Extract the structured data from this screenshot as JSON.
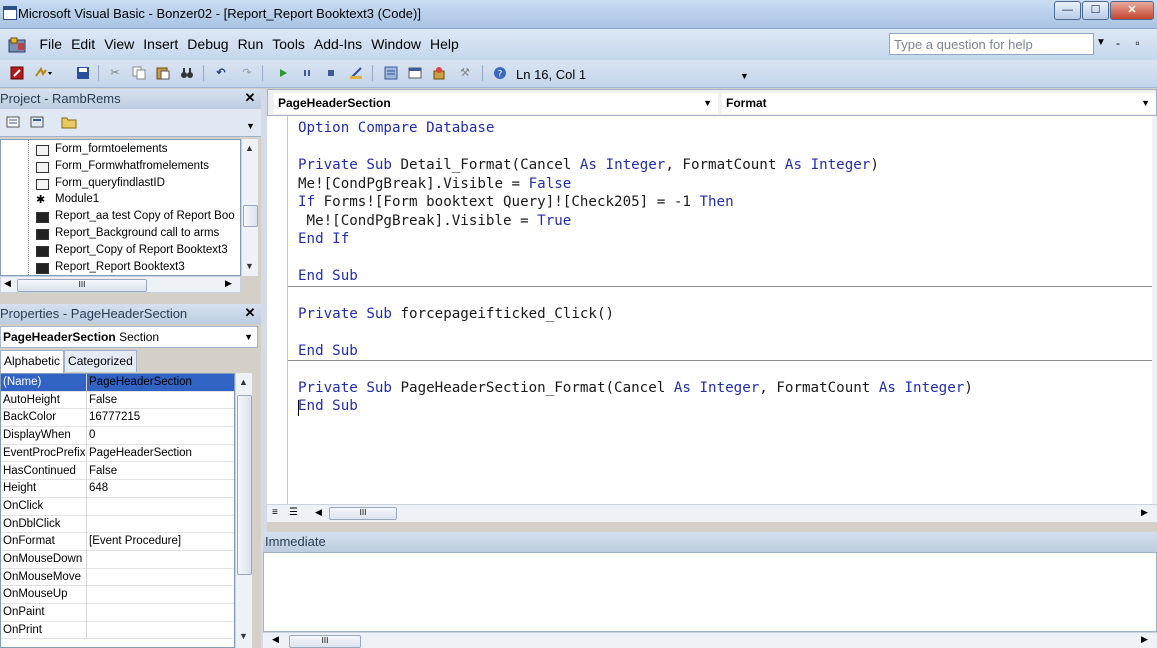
{
  "window": {
    "title": "Microsoft Visual Basic - Bonzer02 - [Report_Report Booktext3 (Code)]",
    "min_label": "—",
    "max_label": "☐",
    "close_label": "✕"
  },
  "menu": {
    "items": [
      "File",
      "Edit",
      "View",
      "Insert",
      "Debug",
      "Run",
      "Tools",
      "Add-Ins",
      "Window",
      "Help"
    ],
    "help_placeholder": "Type a question for help",
    "mdi_buttons": "- ▫"
  },
  "toolbar": {
    "position": "Ln 16, Col 1",
    "overflow": "▼"
  },
  "project": {
    "title": "Project - RambRems",
    "close": "✕",
    "tree": [
      {
        "label": "Form_formtoelements",
        "kind": "form"
      },
      {
        "label": "Form_Formwhatfromelements",
        "kind": "form"
      },
      {
        "label": "Form_queryfindlastID",
        "kind": "form"
      },
      {
        "label": "Module1",
        "kind": "module"
      },
      {
        "label": "Report_aa test Copy of Report Boo",
        "kind": "report"
      },
      {
        "label": "Report_Background call to arms",
        "kind": "report"
      },
      {
        "label": "Report_Copy of Report Booktext3",
        "kind": "report"
      },
      {
        "label": "Report_Report Booktext3",
        "kind": "report"
      }
    ],
    "hscroll_thumb": "III"
  },
  "properties": {
    "title": "Properties - PageHeaderSection",
    "close": "✕",
    "object_name": "PageHeaderSection",
    "object_type": "Section",
    "tabs": [
      "Alphabetic",
      "Categorized"
    ],
    "rows": [
      {
        "name": "(Name)",
        "value": "PageHeaderSection"
      },
      {
        "name": "AutoHeight",
        "value": "False"
      },
      {
        "name": "BackColor",
        "value": "16777215"
      },
      {
        "name": "DisplayWhen",
        "value": "0"
      },
      {
        "name": "EventProcPrefix",
        "value": "PageHeaderSection"
      },
      {
        "name": "HasContinued",
        "value": "False"
      },
      {
        "name": "Height",
        "value": "648"
      },
      {
        "name": "OnClick",
        "value": ""
      },
      {
        "name": "OnDblClick",
        "value": ""
      },
      {
        "name": "OnFormat",
        "value": "[Event Procedure]"
      },
      {
        "name": "OnMouseDown",
        "value": ""
      },
      {
        "name": "OnMouseMove",
        "value": ""
      },
      {
        "name": "OnMouseUp",
        "value": ""
      },
      {
        "name": "OnPaint",
        "value": ""
      },
      {
        "name": "OnPrint",
        "value": ""
      }
    ]
  },
  "code": {
    "object_combo": "PageHeaderSection",
    "proc_combo": "Format",
    "lines": [
      "Option Compare Database",
      "",
      "Private Sub Detail_Format(Cancel As Integer, FormatCount As Integer)",
      "Me![CondPgBreak].Visible = False",
      "If Forms![Form booktext Query]![Check205] = -1 Then",
      " Me![CondPgBreak].Visible = True",
      "End If",
      "",
      "End Sub",
      "",
      "Private Sub forcepageifticked_Click()",
      "",
      "End Sub",
      "",
      "Private Sub PageHeaderSection_Format(Cancel As Integer, FormatCount As Integer)",
      "End Sub"
    ],
    "hscroll_thumb": "III"
  },
  "immediate": {
    "title": "Immediate",
    "hscroll_thumb": "III"
  }
}
